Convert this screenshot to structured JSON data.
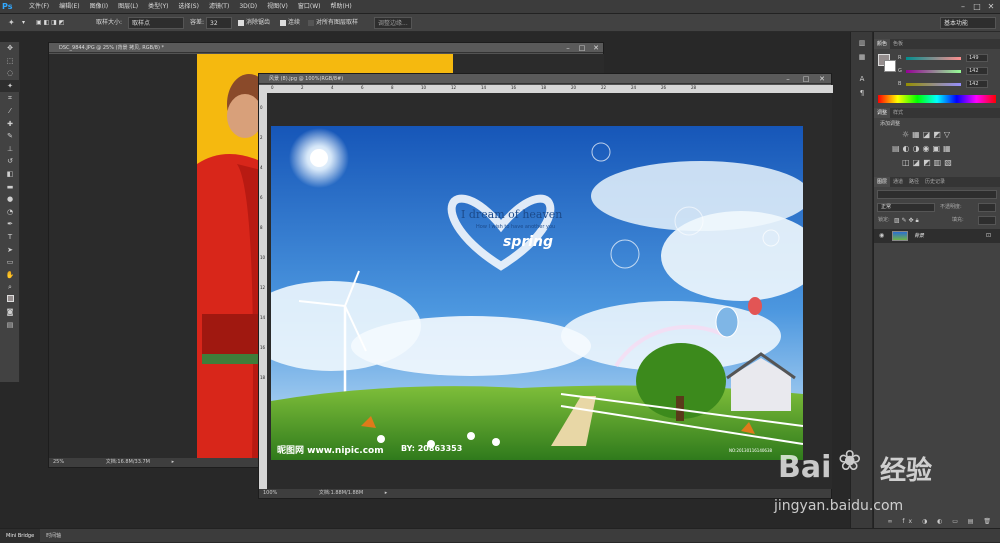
{
  "app": {
    "logo": "Ps"
  },
  "menu": [
    "文件(F)",
    "编辑(E)",
    "图像(I)",
    "图层(L)",
    "类型(Y)",
    "选择(S)",
    "滤镜(T)",
    "3D(D)",
    "视图(V)",
    "窗口(W)",
    "帮助(H)"
  ],
  "window_controls": [
    "–",
    "□",
    "✕"
  ],
  "options": {
    "sample_size_label": "取样大小:",
    "sample_size_value": "取样点",
    "tolerance_label": "容差:",
    "tolerance_value": "32",
    "antialias_label": "消除锯齿",
    "contiguous_label": "连续",
    "sample_all_label": "对所有图层取样",
    "refine_edge_label": "调整边缘...",
    "workspace": "基本功能"
  },
  "doc_back": {
    "title": "DSC_9844.JPG @ 25% (背景 拷贝, RGB/8) *",
    "zoom": "25%",
    "doc_size": "文档:16.8M/33.7M"
  },
  "doc_front": {
    "title": "风景 (8).jpg @ 100%(RGB/8#)",
    "zoom": "100%",
    "doc_size": "文档:1.88M/1.88M",
    "image_text_main": "I dream of heaven",
    "image_text_sub": "How I wish to have another you",
    "image_text_spring": "spring",
    "image_text_site": "昵图网 www.nipic.com",
    "image_text_id": "BY: 20863353",
    "image_text_code": "NO:20130116140638"
  },
  "ruler_ticks": [
    "0",
    "2",
    "4",
    "6",
    "8",
    "10",
    "12",
    "14",
    "16",
    "18",
    "20",
    "22",
    "24",
    "26",
    "28"
  ],
  "ruler_v_ticks": [
    "0",
    "2",
    "4",
    "6",
    "8",
    "10",
    "12",
    "14",
    "16",
    "18"
  ],
  "color_panel": {
    "tabs": [
      "颜色",
      "色板"
    ],
    "r_label": "R",
    "r_value": "149",
    "g_label": "G",
    "g_value": "142",
    "b_label": "B",
    "b_value": "142"
  },
  "adjust_panel": {
    "tabs": [
      "调整",
      "样式"
    ],
    "title": "添加调整"
  },
  "layers_panel": {
    "tabs": [
      "图层",
      "通道",
      "路径",
      "历史记录"
    ],
    "blend_mode": "正常",
    "opacity_label": "不透明度:",
    "lock_label": "锁定:",
    "fill_label": "填充:",
    "layer_name": "背景"
  },
  "bottom_tabs": [
    "Mini Bridge",
    "时间轴"
  ],
  "watermark": {
    "brand": "Bai",
    "brand2": "经验",
    "url": "jingyan.baidu.com"
  },
  "colors": {
    "accent": "#31a8ff",
    "bg": "#282828",
    "panel": "#424242"
  }
}
